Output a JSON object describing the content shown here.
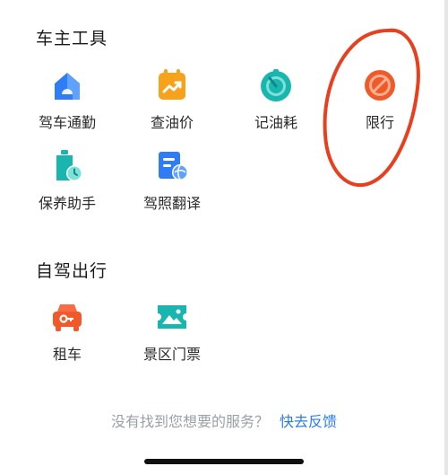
{
  "sections": [
    {
      "title": "车主工具",
      "items": [
        {
          "label": "驾车通勤",
          "icon": "commute-house-icon"
        },
        {
          "label": "查油价",
          "icon": "oil-price-chart-icon"
        },
        {
          "label": "记油耗",
          "icon": "fuel-gauge-icon"
        },
        {
          "label": "限行",
          "icon": "no-entry-icon"
        },
        {
          "label": "保养助手",
          "icon": "maintenance-clock-icon"
        },
        {
          "label": "驾照翻译",
          "icon": "license-translate-icon"
        }
      ]
    },
    {
      "title": "自驾出行",
      "items": [
        {
          "label": "租车",
          "icon": "car-rental-icon"
        },
        {
          "label": "景区门票",
          "icon": "scenic-ticket-icon"
        }
      ]
    }
  ],
  "feedback": {
    "prompt": "没有找到您想要的服务？",
    "link": "快去反馈"
  },
  "colors": {
    "blue": "#2f7df6",
    "orange": "#f7a21b",
    "teal": "#19b6b0",
    "red_orange": "#f05a2b",
    "annotation_red": "#e8401f"
  }
}
